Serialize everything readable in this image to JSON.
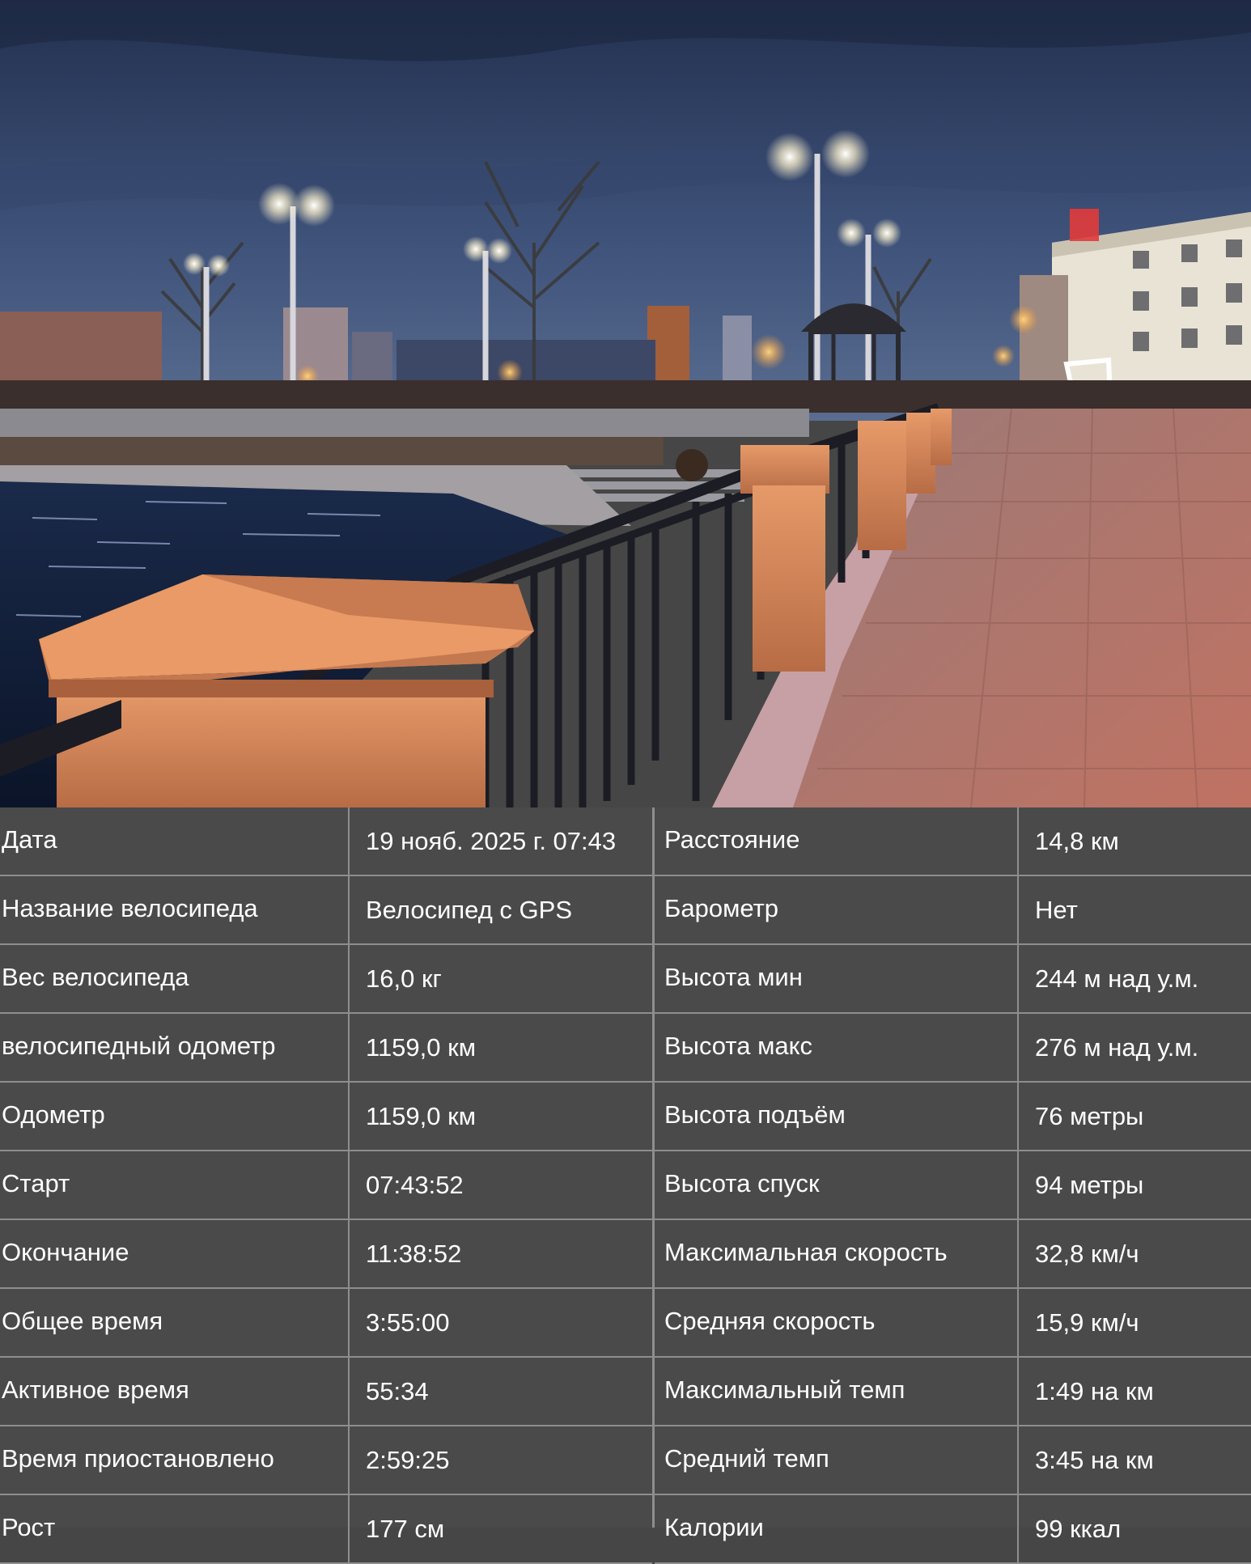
{
  "photo": {
    "scene": "night embankment with granite parapet, iron railing, street lamps and illuminated buildings",
    "colors": {
      "sky_top": "#2b3a5e",
      "sky_bottom": "#4a5f86",
      "water": "#0e1b33",
      "granite": "#d98a5a",
      "pavement": "#b87563",
      "railing": "#1c1c24",
      "lamp": "#fff6d8"
    }
  },
  "stats": {
    "left": [
      {
        "label": "Дата",
        "value": "19 нояб. 2025 г. 07:43"
      },
      {
        "label": "Название велосипеда",
        "value": "Велосипед с GPS"
      },
      {
        "label": "Вес велосипеда",
        "value": "16,0 кг"
      },
      {
        "label": "велосипедный одометр",
        "value": "1159,0 км"
      },
      {
        "label": "Одометр",
        "value": "1159,0 км"
      },
      {
        "label": "Старт",
        "value": "07:43:52"
      },
      {
        "label": "Окончание",
        "value": "11:38:52"
      },
      {
        "label": "Общее время",
        "value": "3:55:00"
      },
      {
        "label": "Активное время",
        "value": "55:34"
      },
      {
        "label": "Время приостановлено",
        "value": "2:59:25"
      },
      {
        "label": "Рост",
        "value": "177 см"
      }
    ],
    "right": [
      {
        "label": "Расстояние",
        "value": "14,8 км"
      },
      {
        "label": "Барометр",
        "value": "Нет"
      },
      {
        "label": "Высота мин",
        "value": "244 м над у.м."
      },
      {
        "label": "Высота макс",
        "value": "276 м над у.м."
      },
      {
        "label": "Высота подъём",
        "value": "76 метры"
      },
      {
        "label": "Высота спуск",
        "value": "94 метры"
      },
      {
        "label": "Максимальная скорость",
        "value": "32,8 км/ч"
      },
      {
        "label": "Средняя скорость",
        "value": "15,9 км/ч"
      },
      {
        "label": "Максимальный темп",
        "value": "1:49 на км"
      },
      {
        "label": "Средний темп",
        "value": "3:45 на км"
      },
      {
        "label": "Калории",
        "value": "99 ккал"
      }
    ]
  }
}
